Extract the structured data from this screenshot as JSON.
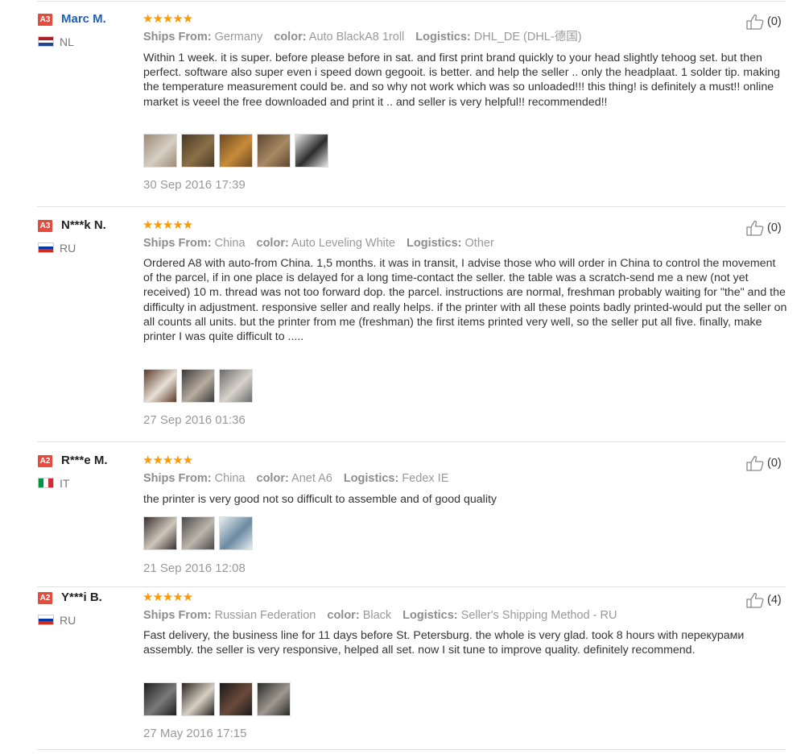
{
  "labels": {
    "ships_from": "Ships From:",
    "color": "color:",
    "logistics": "Logistics:"
  },
  "reviews": [
    {
      "level": "A3",
      "name": "Marc M.",
      "name_linked": true,
      "country": "NL",
      "flag_colors": [
        "#ae1c28",
        "#ffffff",
        "#21468b"
      ],
      "flag_orientation": "horizontal",
      "stars": "★★★★★",
      "rating": 5,
      "ships_from": "Germany",
      "color": "Auto BlackA8 1roll",
      "logistics": "DHL_DE (DHL-德国)",
      "text": "Within 1 week. it is super. before please before in sat. and first print brand quickly to your head slightly tehoog set. but then perfect. software also super even i speed down gegooit. is better. and help the seller .. only the headplaat. 1 solder tip. making the temperature measurement could be. and so why not work which was so unloaded!!! this thing! is definitely a must!! online market is veeel the free downloaded and print it .. and seller is very helpful!! recommended!!",
      "photo_colors": [
        [
          "#9c8a74",
          "#d6cfc4"
        ],
        [
          "#4b3a26",
          "#8b7048"
        ],
        [
          "#6b4a22",
          "#c88b3a"
        ],
        [
          "#5e4630",
          "#a88a64"
        ],
        [
          "#e8e8e8",
          "#2c2c2c"
        ]
      ],
      "date": "30 Sep 2016 17:39",
      "helpful_count": "(0)"
    },
    {
      "level": "A3",
      "name": "N***k N.",
      "name_linked": false,
      "country": "RU",
      "flag_colors": [
        "#ffffff",
        "#0039a6",
        "#d52b1e"
      ],
      "flag_orientation": "horizontal",
      "stars": "★★★★★",
      "rating": 5,
      "ships_from": "China",
      "color": "Auto Leveling White",
      "logistics": "Other",
      "text": "Ordered A8 with auto-from China. 1,5 months. it was in transit, I advise those who will order in China to control the movement of the parcel, if in one place is delayed for a long time-contact the seller. the table was a scratch-send me a new (not yet received) 10 m. thread was not too forward dop. the parcel. instructions are normal, freshman probably waiting for \"the\" and the difficulty in adjustment. responsive seller and really helps. if the printer with all these points badly printed-would put the seller on all counts all units. but the printer from me (freshman) the first items printed very well, so the seller put all five. finally, make printer I was quite difficult to .....",
      "photo_colors": [
        [
          "#5a3a2a",
          "#e8e0d6"
        ],
        [
          "#3a3a3a",
          "#b8aca0"
        ],
        [
          "#6a6a6a",
          "#d8d4cc"
        ]
      ],
      "date": "27 Sep 2016 01:36",
      "helpful_count": "(0)"
    },
    {
      "level": "A2",
      "name": "R***e M.",
      "name_linked": false,
      "country": "IT",
      "flag_colors": [
        "#009246",
        "#ffffff",
        "#ce2b37"
      ],
      "flag_orientation": "vertical",
      "stars": "★★★★★",
      "rating": 5,
      "ships_from": "China",
      "color": "Anet A6",
      "logistics": "Fedex IE",
      "text": "the printer is very good not so difficult to assemble and of good quality",
      "photo_colors": [
        [
          "#3a3030",
          "#cfc6bc"
        ],
        [
          "#4a4a4a",
          "#bdb6ac"
        ],
        [
          "#e6eef2",
          "#6a8aa0"
        ]
      ],
      "date": "21 Sep 2016 12:08",
      "helpful_count": "(0)"
    },
    {
      "level": "A2",
      "name": "Y***i B.",
      "name_linked": false,
      "country": "RU",
      "flag_colors": [
        "#ffffff",
        "#0039a6",
        "#d52b1e"
      ],
      "flag_orientation": "horizontal",
      "stars": "★★★★★",
      "rating": 5,
      "ships_from": "Russian Federation",
      "color": "Black",
      "logistics": "Seller's Shipping Method - RU",
      "text": "Fast delivery, the business line for 11 days before St. Petersburg. the whole is very glad. took 8 hours with перекурами assembly. the seller is very responsive, helped all set. now I sit tune to improve quality. definitely recommend.",
      "photo_colors": [
        [
          "#1e1e1e",
          "#7a7a7a"
        ],
        [
          "#2a2420",
          "#d8d0c4"
        ],
        [
          "#1a1a1a",
          "#6a4a3a"
        ],
        [
          "#2a2a2a",
          "#a09890"
        ]
      ],
      "date": "27 May 2016 17:15",
      "helpful_count": "(4)"
    }
  ]
}
